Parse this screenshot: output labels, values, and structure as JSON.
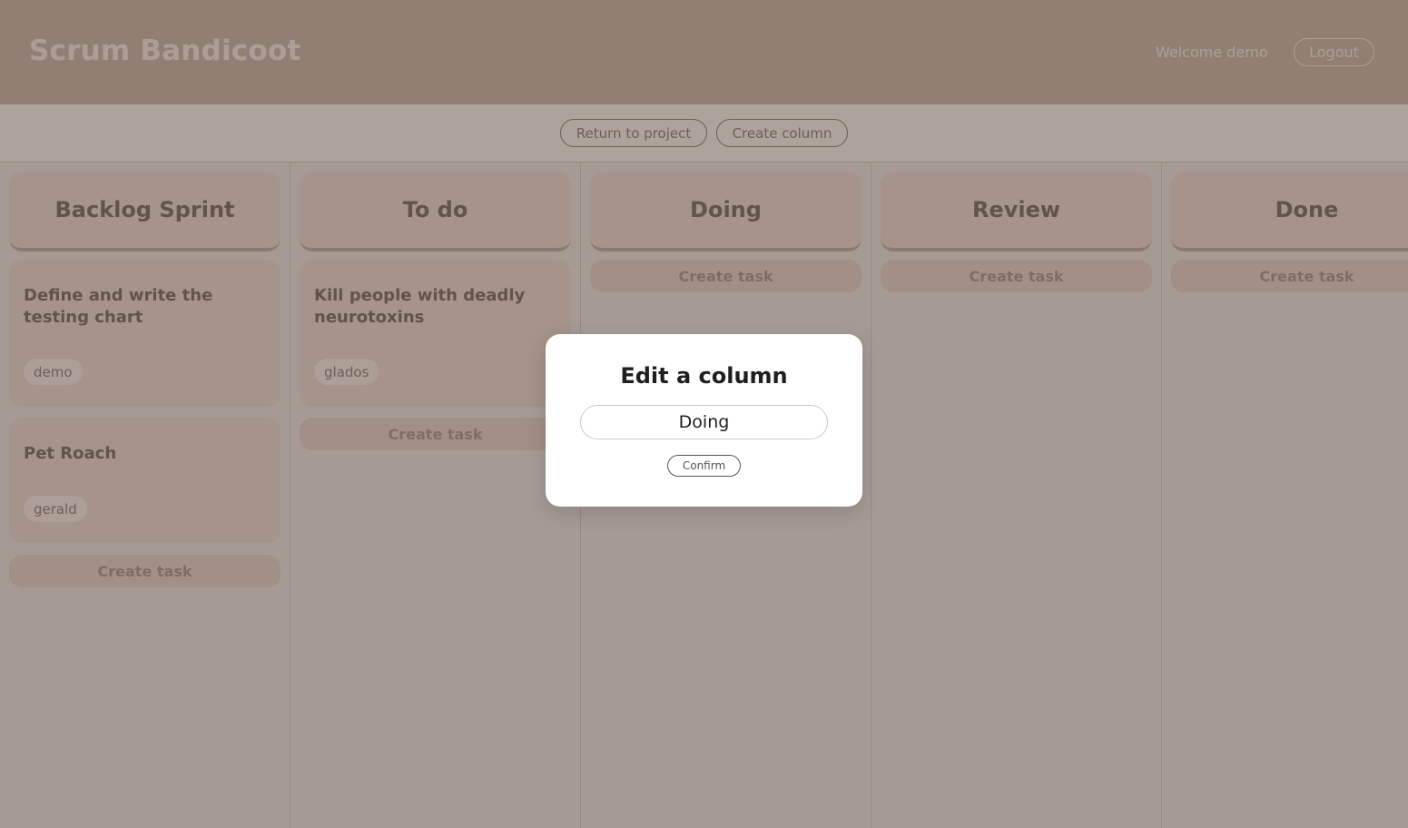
{
  "header": {
    "app_title": "Scrum Bandicoot",
    "welcome_text": "Welcome demo",
    "logout_label": "Logout"
  },
  "toolbar": {
    "return_label": "Return to project",
    "create_column_label": "Create column"
  },
  "columns": [
    {
      "title": "Backlog Sprint",
      "tasks": [
        {
          "title": "Define and write the testing chart",
          "assignee": "demo"
        },
        {
          "title": "Pet Roach",
          "assignee": "gerald"
        }
      ],
      "create_task_label": "Create task"
    },
    {
      "title": "To do",
      "tasks": [
        {
          "title": "Kill people with deadly neurotoxins",
          "assignee": "glados"
        }
      ],
      "create_task_label": "Create task"
    },
    {
      "title": "Doing",
      "tasks": [],
      "create_task_label": "Create task"
    },
    {
      "title": "Review",
      "tasks": [],
      "create_task_label": "Create task"
    },
    {
      "title": "Done",
      "tasks": [],
      "create_task_label": "Create task"
    }
  ],
  "modal": {
    "title": "Edit a column",
    "input_value": "Doing",
    "confirm_label": "Confirm"
  }
}
